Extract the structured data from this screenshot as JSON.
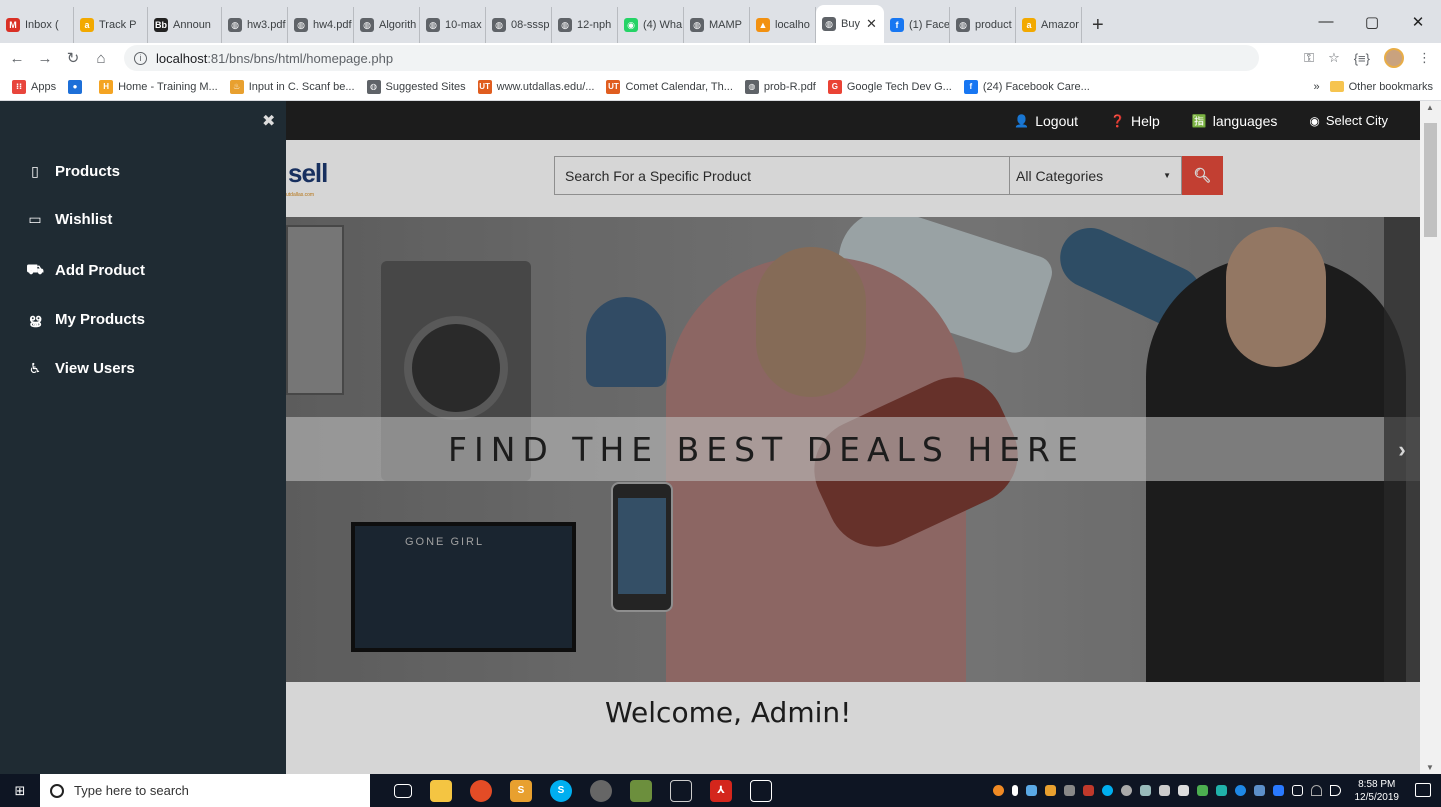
{
  "browser": {
    "tabs": [
      {
        "label": "Inbox (",
        "icon": "gmail-icon",
        "color": "#d93025",
        "glyph": "M"
      },
      {
        "label": "Track P",
        "icon": "amazon-icon",
        "color": "#f2a900",
        "glyph": "a"
      },
      {
        "label": "Announ",
        "icon": "blackboard-icon",
        "color": "#222",
        "glyph": "Bb"
      },
      {
        "label": "hw3.pdf",
        "icon": "globe-icon",
        "color": "#5f6368",
        "glyph": "◍"
      },
      {
        "label": "hw4.pdf",
        "icon": "globe-icon",
        "color": "#5f6368",
        "glyph": "◍"
      },
      {
        "label": "Algorith",
        "icon": "globe-icon",
        "color": "#5f6368",
        "glyph": "◍"
      },
      {
        "label": "10-max",
        "icon": "globe-icon",
        "color": "#5f6368",
        "glyph": "◍"
      },
      {
        "label": "08-sssp",
        "icon": "globe-icon",
        "color": "#5f6368",
        "glyph": "◍"
      },
      {
        "label": "12-nph",
        "icon": "globe-icon",
        "color": "#5f6368",
        "glyph": "◍"
      },
      {
        "label": "(4) Wha",
        "icon": "whatsapp-icon",
        "color": "#25d366",
        "glyph": "◉"
      },
      {
        "label": "MAMP",
        "icon": "globe-icon",
        "color": "#5f6368",
        "glyph": "◍"
      },
      {
        "label": "localho",
        "icon": "phpmyadmin-icon",
        "color": "#f29111",
        "glyph": "▲"
      },
      {
        "label": "Buy",
        "icon": "globe-icon",
        "color": "#5f6368",
        "glyph": "◍",
        "active": true
      },
      {
        "label": "(1) Face",
        "icon": "facebook-icon",
        "color": "#1877f2",
        "glyph": "f"
      },
      {
        "label": "product",
        "icon": "globe-icon",
        "color": "#5f6368",
        "glyph": "◍"
      },
      {
        "label": "Amazor",
        "icon": "amazon-icon",
        "color": "#f2a900",
        "glyph": "a"
      }
    ],
    "url_host": "localhost",
    "url_path": ":81/bns/bns/html/homepage.php",
    "bookmarks": [
      {
        "label": "Apps",
        "color": "#e8453c",
        "glyph": "⁝⁝"
      },
      {
        "label": "",
        "color": "#1d6fd8",
        "glyph": "●"
      },
      {
        "label": "Home - Training M...",
        "color": "#f4a423",
        "glyph": "H"
      },
      {
        "label": "Input in C. Scanf be...",
        "color": "#e8a02f",
        "glyph": "♨"
      },
      {
        "label": "Suggested Sites",
        "color": "#5f6368",
        "glyph": "◍"
      },
      {
        "label": "www.utdallas.edu/...",
        "color": "#e05d1f",
        "glyph": "UT"
      },
      {
        "label": "Comet Calendar, Th...",
        "color": "#e05d1f",
        "glyph": "UT"
      },
      {
        "label": "prob-R.pdf",
        "color": "#5f6368",
        "glyph": "◍"
      },
      {
        "label": "Google Tech Dev G...",
        "color": "#ea4335",
        "glyph": "G"
      },
      {
        "label": "(24) Facebook Care...",
        "color": "#1877f2",
        "glyph": "f"
      }
    ],
    "other_bookmarks": "Other bookmarks"
  },
  "site": {
    "topbar": {
      "logout": "Logout",
      "help": "Help",
      "languages": "languages",
      "select_city": "Select City"
    },
    "logo_text": "sell",
    "logo_sub": "utdallas.com",
    "search_placeholder": "Search For a Specific Product",
    "category_selected": "All Categories",
    "banner_text": "FIND THE BEST DEALS HERE",
    "banner_tv_text": "GONE GIRL",
    "welcome": "Welcome, Admin!"
  },
  "sidebar": {
    "items": [
      {
        "label": "Products",
        "icon": "mobile-icon",
        "glyph": "▯"
      },
      {
        "label": "Wishlist",
        "icon": "laptop-icon",
        "glyph": "▭"
      },
      {
        "label": "Add Product",
        "icon": "car-icon",
        "glyph": "⛟"
      },
      {
        "label": "My Products",
        "icon": "motorcycle-icon",
        "glyph": "ൠ"
      },
      {
        "label": "View Users",
        "icon": "wheelchair-icon",
        "glyph": "♿"
      }
    ]
  },
  "taskbar": {
    "search_placeholder": "Type here to search",
    "time": "8:58 PM",
    "date": "12/5/2019"
  }
}
